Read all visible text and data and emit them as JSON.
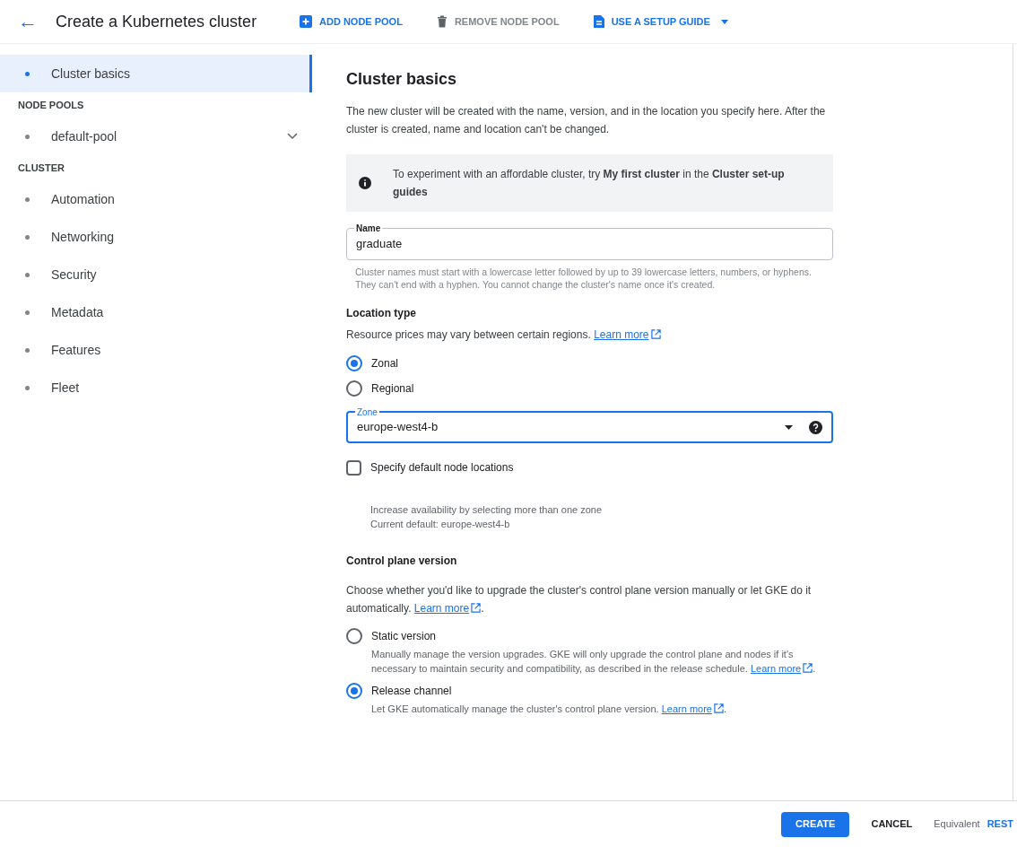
{
  "header": {
    "back": "←",
    "title": "Create a Kubernetes cluster",
    "actions": [
      {
        "label": "ADD NODE POOL",
        "kind": "add",
        "disabled": false
      },
      {
        "label": "REMOVE NODE POOL",
        "kind": "remove",
        "disabled": true
      },
      {
        "label": "USE A SETUP GUIDE",
        "kind": "guide",
        "disabled": false,
        "dropdown": true
      }
    ]
  },
  "sidebar": {
    "items": [
      {
        "kind": "item",
        "label": "Cluster basics",
        "selected": true
      },
      {
        "kind": "header",
        "label": "NODE POOLS"
      },
      {
        "kind": "item",
        "label": "default-pool",
        "selected": false,
        "expandable": true
      },
      {
        "kind": "header",
        "label": "CLUSTER"
      },
      {
        "kind": "item",
        "label": "Automation",
        "selected": false
      },
      {
        "kind": "item",
        "label": "Networking",
        "selected": false
      },
      {
        "kind": "item",
        "label": "Security",
        "selected": false
      },
      {
        "kind": "item",
        "label": "Metadata",
        "selected": false
      },
      {
        "kind": "item",
        "label": "Features",
        "selected": false
      },
      {
        "kind": "item",
        "label": "Fleet",
        "selected": false
      }
    ]
  },
  "main": {
    "title": "Cluster basics",
    "intro": "The new cluster will be created with the name, version, and in the location you specify here. After the cluster is created, name and location can't be changed.",
    "banner": "To experiment with an affordable cluster, try **My first cluster** in the **Cluster set-up guides**",
    "name_field": {
      "label": "Name",
      "value": "graduate",
      "hint": "Cluster names must start with a lowercase letter followed by up to 39 lowercase letters, numbers, or hyphens. They can't end with a hyphen. You cannot change the cluster's name once it's created."
    },
    "location_type": {
      "title": "Location type",
      "text": "Resource prices may vary between certain regions.",
      "link": "Learn more",
      "options": [
        {
          "label": "Zonal",
          "selected": true
        },
        {
          "label": "Regional",
          "selected": false
        }
      ]
    },
    "zone_field": {
      "label": "Zone",
      "value": "europe-west4-b",
      "focused": true
    },
    "node_locations": {
      "label": "Specify default node locations",
      "checked": false,
      "notes": [
        "Increase availability by selecting more than one zone",
        "Current default: europe-west4-b"
      ]
    },
    "control_plane": {
      "title": "Control plane version",
      "text": "Choose whether you'd like to upgrade the cluster's control plane version manually or let GKE do it automatically.",
      "link": "Learn more",
      "suffix": ".",
      "options": [
        {
          "label": "Static version",
          "selected": false,
          "text": "Manually manage the version upgrades. GKE will only upgrade the control plane and nodes if it's necessary to maintain security and compatibility, as described in the release schedule.",
          "link": "Learn more",
          "suffix": "."
        },
        {
          "label": "Release channel",
          "selected": true,
          "text": "Let GKE automatically manage the cluster's control plane version.",
          "link": "Learn more",
          "suffix": "."
        }
      ]
    }
  },
  "footer": {
    "create": "CREATE",
    "cancel": "CANCEL",
    "equivalent": "Equivalent",
    "rest": "REST"
  }
}
